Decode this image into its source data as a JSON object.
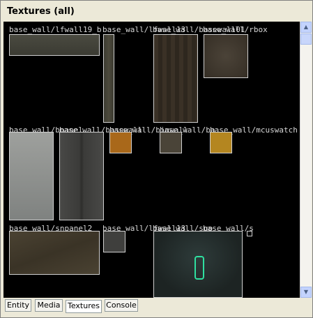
{
  "window": {
    "title": "Textures (all)"
  },
  "textures": [
    {
      "label": "base_wall/lfwall19_b"
    },
    {
      "label": "base_wall/lfwall13"
    },
    {
      "label": "base_wall/basewall01"
    },
    {
      "label": "base_wall/b"
    },
    {
      "label": "base_wall/rbox"
    },
    {
      "label": "base_wall/bpanel"
    },
    {
      "label": "base_wall/basewall"
    },
    {
      "label": "base_wall/bigwall"
    },
    {
      "label": "base_wall/ba"
    },
    {
      "label": "base_wall/mcuswatch"
    },
    {
      "label": "base_wall/snpanel2"
    },
    {
      "label": "base_wall/lfwall13"
    },
    {
      "label": "base_wall/sup"
    },
    {
      "label": "base_wall/s"
    }
  ],
  "scrollbar": {
    "up_icon": "scroll-up-arrow",
    "down_icon": "scroll-down-arrow"
  },
  "tabs": [
    {
      "label": "Entity"
    },
    {
      "label": "Media"
    },
    {
      "label": "Textures"
    },
    {
      "label": "Console"
    }
  ]
}
